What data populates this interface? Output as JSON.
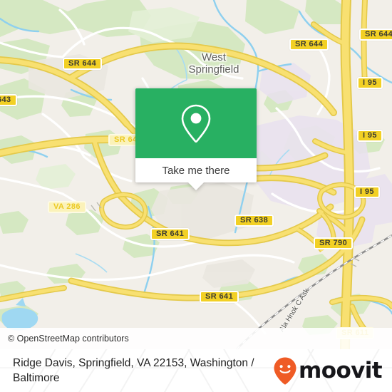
{
  "map": {
    "place_labels": [
      {
        "name": "west-springfield",
        "line1": "West",
        "line2": "Springfield"
      }
    ],
    "road_shields": [
      {
        "name": "shield-sr-643",
        "label": "643",
        "style": "dark"
      },
      {
        "name": "shield-sr-644-nw",
        "label": "SR 644",
        "style": "dark"
      },
      {
        "name": "shield-sr-644-n",
        "label": "SR 644",
        "style": "dark"
      },
      {
        "name": "shield-sr-644-ne",
        "label": "SR 644",
        "style": "dark"
      },
      {
        "name": "shield-i-95-a",
        "label": "I 95",
        "style": "dark"
      },
      {
        "name": "shield-i-95-b",
        "label": "I 95",
        "style": "dark"
      },
      {
        "name": "shield-i-95-c",
        "label": "I 95",
        "style": "dark"
      },
      {
        "name": "shield-sr-644-w",
        "label": "SR 64",
        "style": "light"
      },
      {
        "name": "shield-va-286",
        "label": "VA 286",
        "style": "light"
      },
      {
        "name": "shield-sr-641-a",
        "label": "SR 641",
        "style": "dark"
      },
      {
        "name": "shield-sr-641-b",
        "label": "SR 641",
        "style": "dark"
      },
      {
        "name": "shield-sr-638",
        "label": "SR 638",
        "style": "dark"
      },
      {
        "name": "shield-sr-790",
        "label": "SR 790",
        "style": "dark"
      },
      {
        "name": "shield-sr-611",
        "label": "SR 611",
        "style": "light"
      }
    ],
    "road_name_rotated": "Ala Hnok C Ask",
    "attribution": "© OpenStreetMap contributors",
    "colors": {
      "land": "#f2efe9",
      "green": "#cfe5b8",
      "forest": "#d6ecc4",
      "water": "#8fd3f0",
      "residential": "#e8e0ee",
      "road_major": "#f7e06e",
      "road_minor": "#ffffff",
      "road_casing": "#e8c84a"
    }
  },
  "popup": {
    "pin_icon": "map-pin-icon",
    "action_label": "Take me there",
    "header_color": "#28b062"
  },
  "footer": {
    "address": "Ridge Davis, Springfield, VA 22153, Washington / Baltimore",
    "brand": "moovit",
    "brand_icon": "moovit-pin-smiley-icon",
    "brand_color": "#ef5b25"
  }
}
